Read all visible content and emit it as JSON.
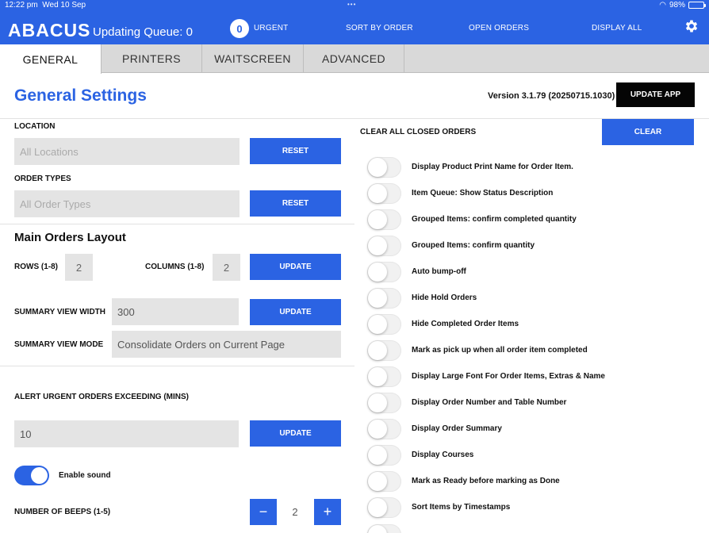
{
  "status": {
    "time": "12:22 pm",
    "date": "Wed 10 Sep",
    "dots": "•••",
    "battery": "98%",
    "battery_level": 0.98
  },
  "header": {
    "brand": "ABACUS",
    "queue_text": "Updating Queue: 0",
    "urgent_count": "0",
    "nav": [
      "URGENT",
      "SORT BY ORDER",
      "OPEN ORDERS",
      "DISPLAY ALL"
    ]
  },
  "tabs": [
    "GENERAL",
    "PRINTERS",
    "WAITSCREEN",
    "ADVANCED"
  ],
  "page": {
    "title": "General Settings",
    "version": "Version 3.1.79 (20250715.1030)",
    "update_app": "UPDATE APP"
  },
  "left": {
    "location_label": "LOCATION",
    "location_placeholder": "All Locations",
    "location_reset": "RESET",
    "order_types_label": "ORDER TYPES",
    "order_types_placeholder": "All Order Types",
    "order_types_reset": "RESET",
    "layout_title": "Main Orders Layout",
    "rows_label": "ROWS (1-8)",
    "rows_value": "2",
    "columns_label": "COLUMNS (1-8)",
    "columns_value": "2",
    "layout_update": "UPDATE",
    "summary_width_label": "SUMMARY VIEW WIDTH",
    "summary_width_value": "300",
    "summary_width_update": "UPDATE",
    "summary_mode_label": "SUMMARY VIEW MODE",
    "summary_mode_value": "Consolidate Orders on Current Page",
    "alert_label": "ALERT URGENT ORDERS EXCEEDING (MINS)",
    "alert_value": "10",
    "alert_update": "UPDATE",
    "sound_label": "Enable sound",
    "beeps_label": "NUMBER OF BEEPS (1-5)",
    "beeps_value": "2",
    "minus": "−",
    "plus": "+"
  },
  "right": {
    "clear_label": "CLEAR ALL CLOSED ORDERS",
    "clear_button": "CLEAR",
    "options": [
      "Display Product Print Name for Order Item.",
      "Item Queue: Show Status Description",
      "Grouped Items: confirm completed quantity",
      "Grouped Items: confirm quantity",
      "Auto bump-off",
      "Hide Hold Orders",
      "Hide Completed Order Items",
      "Mark as pick up when all order item completed",
      "Display Large Font For Order Items, Extras & Name",
      "Display Order Number and Table Number",
      "Display Order Summary",
      "Display Courses",
      "Mark as Ready before marking as Done",
      "Sort Items by Timestamps"
    ]
  },
  "colors": {
    "accent": "#2b63e3",
    "dark": "#050505"
  }
}
